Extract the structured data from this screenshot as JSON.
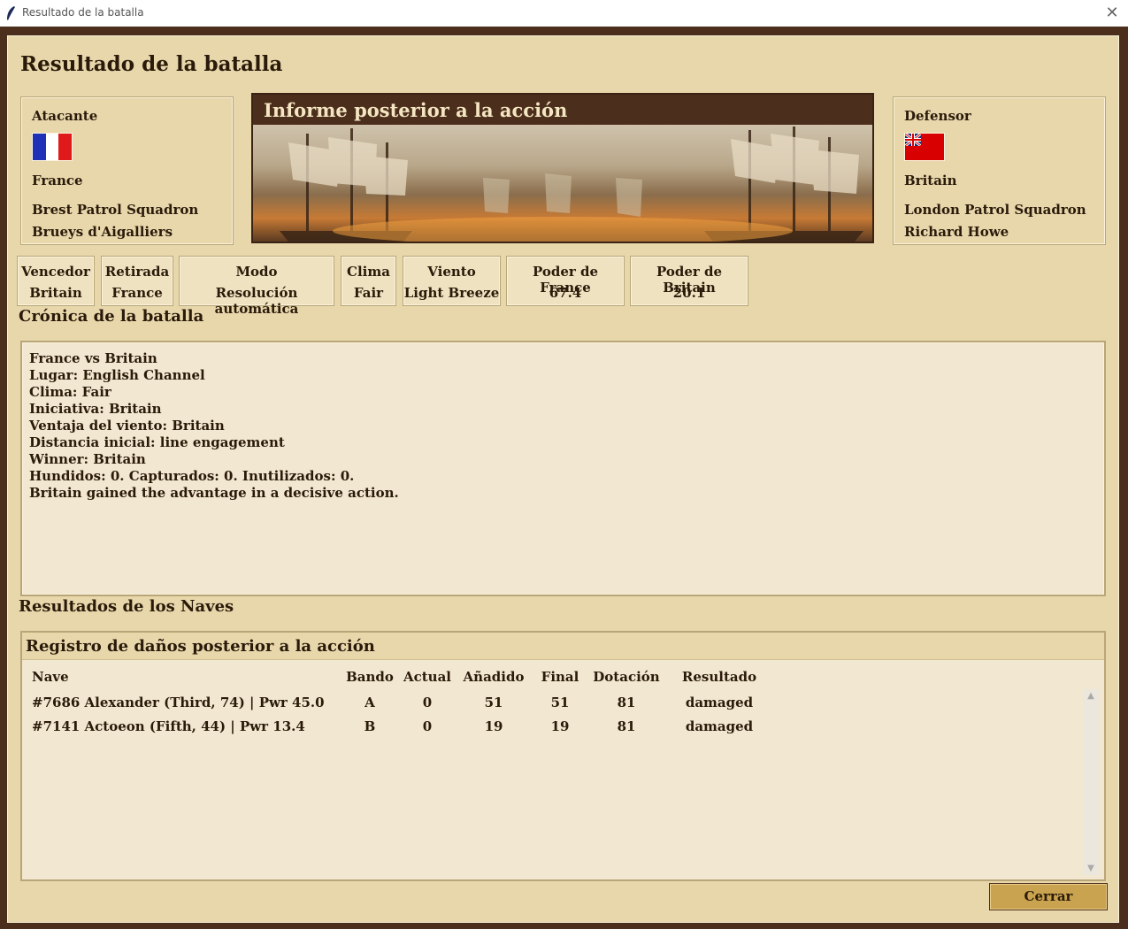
{
  "window": {
    "title": "Resultado de la batalla"
  },
  "page": {
    "title": "Resultado de la batalla"
  },
  "attacker": {
    "role": "Atacante",
    "nation": "France",
    "squadron": "Brest Patrol Squadron",
    "commander": "Brueys d'Aigalliers",
    "flag": [
      "#1f2fb8",
      "#ffffff",
      "#e01a1a"
    ]
  },
  "defender": {
    "role": "Defensor",
    "nation": "Britain",
    "squadron": "London Patrol Squadron",
    "commander": "Richard Howe",
    "flag_color": "#d80000"
  },
  "banner": {
    "title": "Informe posterior a la acción"
  },
  "stats": [
    {
      "label": "Vencedor",
      "value": "Britain"
    },
    {
      "label": "Retirada",
      "value": "France"
    },
    {
      "label": "Modo",
      "value": "Resolución automática"
    },
    {
      "label": "Clima",
      "value": "Fair"
    },
    {
      "label": "Viento",
      "value": "Light Breeze"
    },
    {
      "label": "Poder de France",
      "value": "67.4"
    },
    {
      "label": "Poder de Britain",
      "value": "20.1"
    }
  ],
  "chronicle": {
    "title": "Crónica de la batalla",
    "lines": [
      "France vs Britain",
      "Lugar: English Channel",
      "Clima: Fair",
      "Iniciativa: Britain",
      "Ventaja del viento: Britain",
      "Distancia inicial: line engagement",
      "Winner: Britain",
      "Hundidos: 0. Capturados: 0. Inutilizados: 0.",
      "Britain gained the advantage in a decisive action."
    ]
  },
  "ships": {
    "section_title": "Resultados de los Naves",
    "table_title": "Registro de daños posterior a la acción",
    "columns": [
      "Nave",
      "Bando",
      "Actual",
      "Añadido",
      "Final",
      "Dotación",
      "Resultado"
    ],
    "rows": [
      [
        "#7686 Alexander (Third, 74) | Pwr 45.0",
        "A",
        "0",
        "51",
        "51",
        "81",
        "damaged"
      ],
      [
        "#7141 Actoeon (Fifth, 44) | Pwr 13.4",
        "B",
        "0",
        "19",
        "19",
        "81",
        "damaged"
      ]
    ]
  },
  "buttons": {
    "close": "Cerrar"
  },
  "colors": {
    "frame": "#4c2e1c",
    "panel": "#e8d7ab",
    "button": "#c9a34f"
  }
}
